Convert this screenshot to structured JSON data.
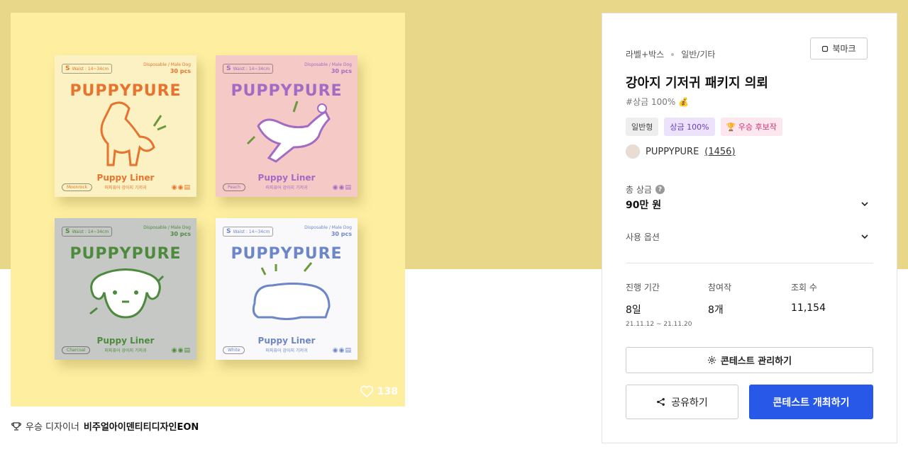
{
  "hero": {
    "likes": "138",
    "boxes": [
      {
        "size": "S",
        "waist": "Waist : 14~34cm",
        "type": "Disposable / Male Dog",
        "count": "30 pcs",
        "brand": "PUPPYPURE",
        "liner": "Puppy Liner",
        "kr": "퍼피퓨어 강아지 기저귀",
        "color": "Moonrock"
      },
      {
        "size": "S",
        "waist": "Waist : 14~34cm",
        "type": "Disposable / Male Dog",
        "count": "30 pcs",
        "brand": "PUPPYPURE",
        "liner": "Puppy Liner",
        "kr": "퍼피퓨어 강아지 기저귀",
        "color": "Peach"
      },
      {
        "size": "S",
        "waist": "Waist : 14~34cm",
        "type": "Disposable / Male Dog",
        "count": "30 pcs",
        "brand": "PUPPYPURE",
        "liner": "Puppy Liner",
        "kr": "퍼피퓨어 강아지 기저귀",
        "color": "Charcoal"
      },
      {
        "size": "S",
        "waist": "Waist : 14~34cm",
        "type": "Disposable / Male Dog",
        "count": "30 pcs",
        "brand": "PUPPYPURE",
        "liner": "Puppy Liner",
        "kr": "퍼피퓨어 강아지 기저귀",
        "color": "White"
      }
    ]
  },
  "winner": {
    "label": "우승 디자이너",
    "name": "비주얼아이덴티티디자인EON"
  },
  "panel": {
    "crumbs": [
      "라벨+박스",
      "일반/기타"
    ],
    "bookmark_label": "북마크",
    "title": "강아지 기저귀 패키지 의뢰",
    "hashtag": "#상금 100% 💰",
    "badges": [
      "일반형",
      "상금 100%",
      "🏆 우승 후보작"
    ],
    "owner": {
      "name": "PUPPYPURE",
      "count": "(1456)"
    },
    "prize_label": "총 상금",
    "prize_value": "90만 원",
    "option_label": "사용 옵션",
    "stats": [
      {
        "label": "진행 기간",
        "value": "8일",
        "sub": "21.11.12 ~ 21.11.20"
      },
      {
        "label": "참여작",
        "value": "8개"
      },
      {
        "label": "조회 수",
        "value": "11,154"
      }
    ],
    "manage_label": "콘테스트 관리하기",
    "share_label": "공유하기",
    "open_label": "콘테스트 개최하기",
    "accent_color": "#2758e8"
  }
}
